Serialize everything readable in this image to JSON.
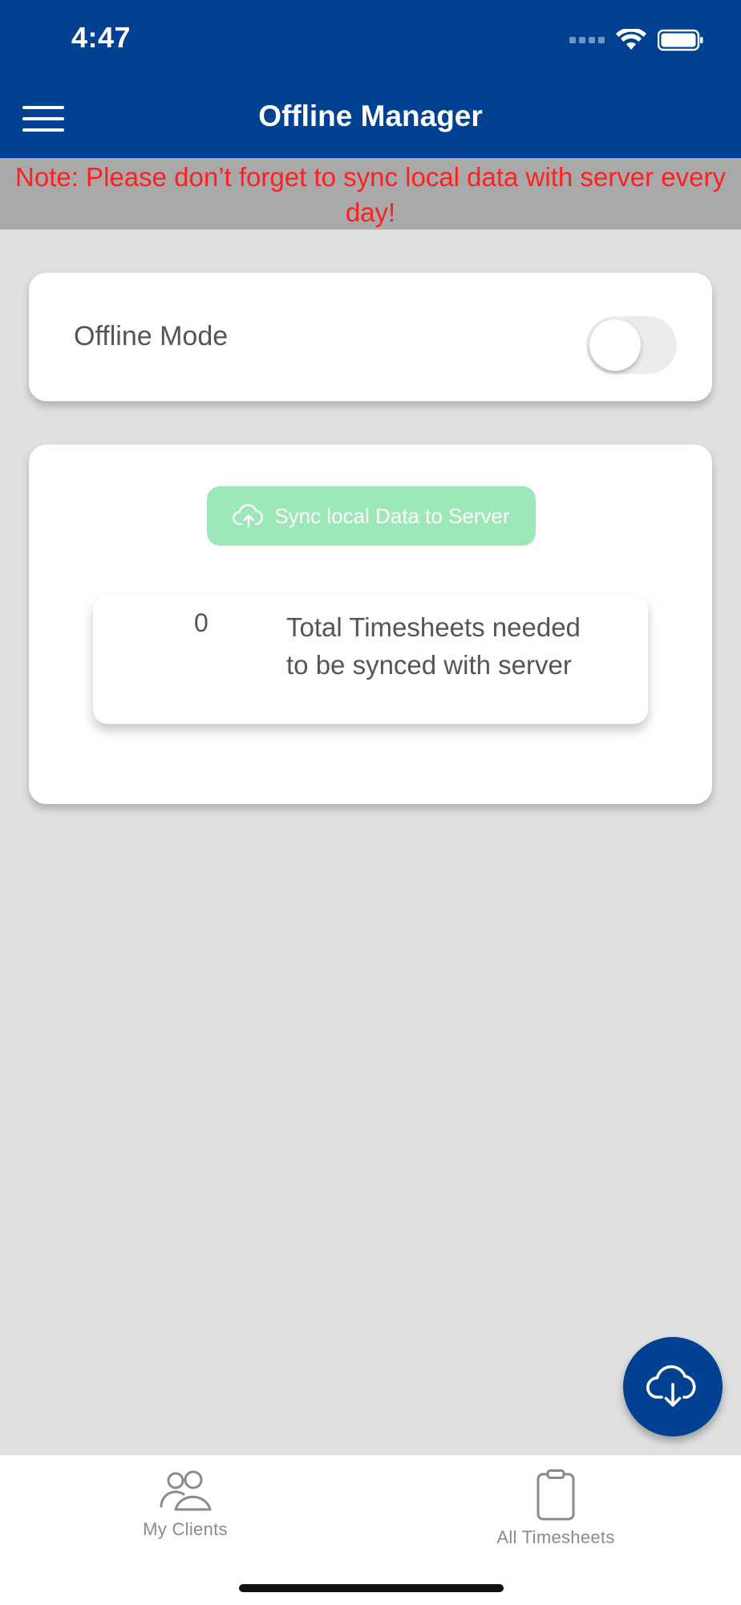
{
  "status_bar": {
    "time": "4:47"
  },
  "header": {
    "title": "Offline Manager",
    "menu_icon": "hamburger-menu-icon"
  },
  "notice": {
    "text": "Note: Please don’t forget to sync local data with server every day!",
    "color": "#ff1f1f"
  },
  "offline_mode": {
    "label": "Offline Mode",
    "enabled": false
  },
  "sync": {
    "button_label": "Sync local Data to Server",
    "button_icon": "cloud-upload-icon",
    "button_color": "#9de8b9",
    "count": "0",
    "count_label": "Total Timesheets needed to be synced with server"
  },
  "fab": {
    "icon": "cloud-download-icon"
  },
  "tabs": [
    {
      "label": "My Clients",
      "icon": "users-icon"
    },
    {
      "label": "All Timesheets",
      "icon": "clipboard-icon"
    }
  ],
  "colors": {
    "primary": "#004193",
    "background": "#e0e0e0"
  }
}
